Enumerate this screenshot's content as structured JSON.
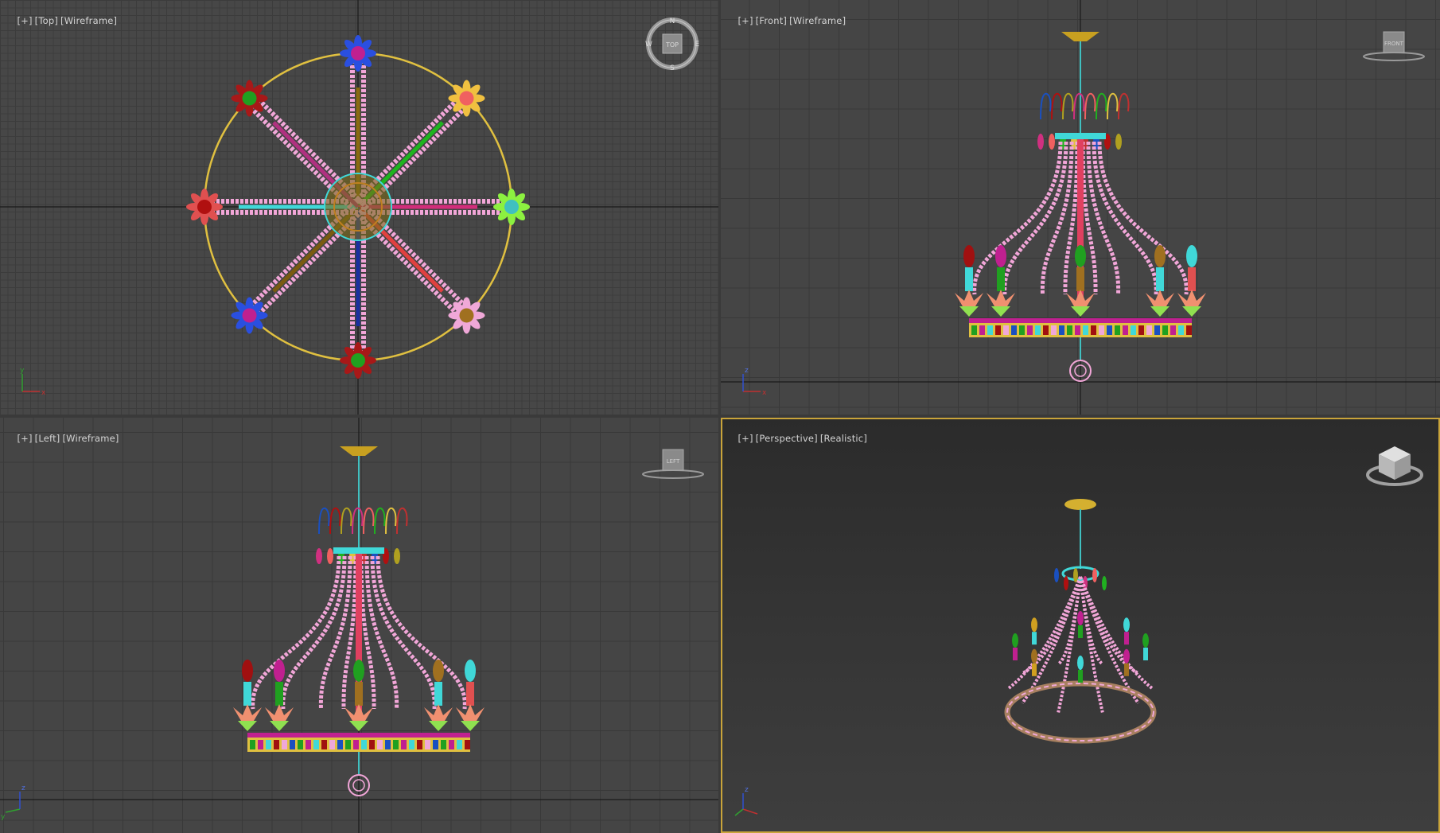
{
  "viewports": {
    "top": {
      "plus": "[+]",
      "view": "[Top]",
      "shading": "[Wireframe]",
      "viewcube_label": "TOP",
      "compass": {
        "n": "N",
        "s": "S",
        "e": "E",
        "w": "W"
      }
    },
    "front": {
      "plus": "[+]",
      "view": "[Front]",
      "shading": "[Wireframe]",
      "viewcube_label": "FRONT"
    },
    "left": {
      "plus": "[+]",
      "view": "[Left]",
      "shading": "[Wireframe]",
      "viewcube_label": "LEFT"
    },
    "perspective": {
      "plus": "[+]",
      "view": "[Perspective]",
      "shading": "[Realistic]"
    }
  },
  "axis_labels": {
    "x": "x",
    "y": "y",
    "z": "z"
  },
  "colors": {
    "active_border": "#c9a43a",
    "bead_pink": "#f2a6d8",
    "gold_ring": "#e0c040",
    "viewport_bg": "#454545"
  },
  "icons": [
    "viewcube-icon",
    "compass-icon",
    "axis-tripod-icon"
  ]
}
